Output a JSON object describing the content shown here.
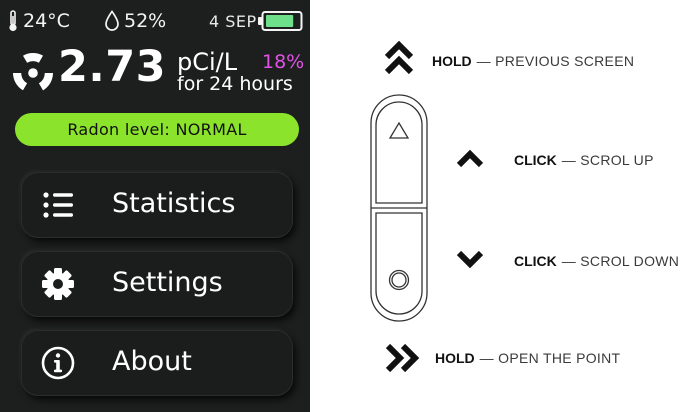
{
  "status_bar": {
    "temperature": "24°C",
    "humidity": "52%",
    "date": "4 SEP",
    "battery_level": 0.85,
    "battery_color": "#6ee08a"
  },
  "reading": {
    "value": "2.73",
    "unit": "pCi/L",
    "percent": "18%",
    "period": "for 24 hours",
    "percent_color": "#e052e6"
  },
  "level": {
    "text": "Radon level: NORMAL",
    "color": "#8be32b"
  },
  "menu": [
    {
      "label": "Statistics",
      "icon": "list-icon"
    },
    {
      "label": "Settings",
      "icon": "gear-icon"
    },
    {
      "label": "About",
      "icon": "info-icon"
    }
  ],
  "legend": {
    "hold_previous": {
      "action": "HOLD",
      "description": "— PREVIOUS SCREEN",
      "icon": "double-chevron-up-icon"
    },
    "click_up": {
      "action": "CLICK",
      "description": "— SCROL UP",
      "icon": "chevron-up-icon"
    },
    "click_down": {
      "action": "CLICK",
      "description": "— SCROL DOWN",
      "icon": "chevron-down-icon"
    },
    "hold_open": {
      "action": "HOLD",
      "description": "— OPEN THE POINT",
      "icon": "double-chevron-right-icon"
    }
  }
}
